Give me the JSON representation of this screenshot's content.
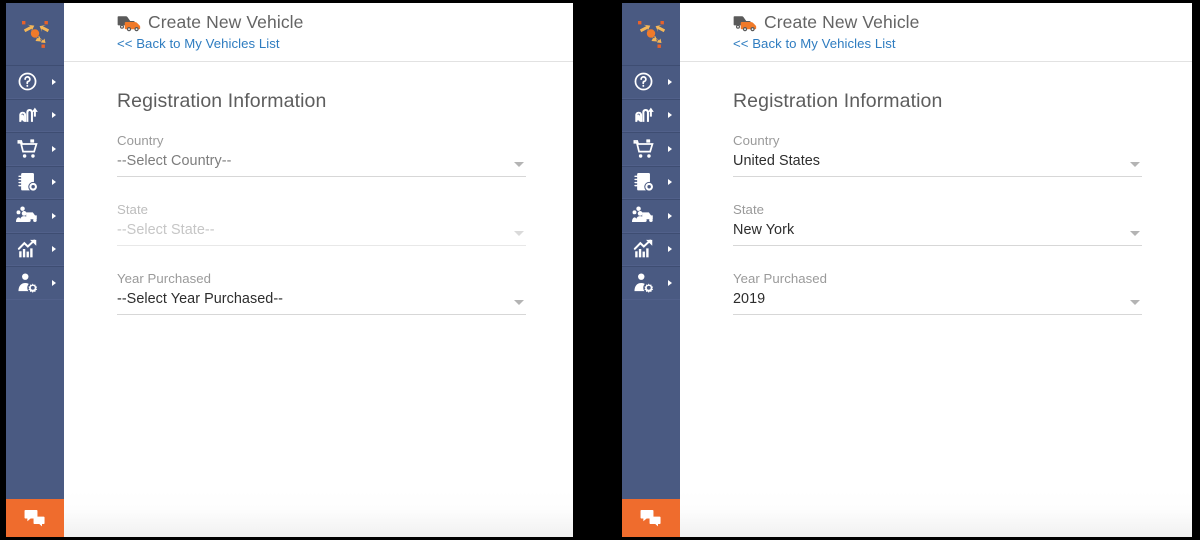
{
  "app": {
    "logo_icon": "route-arrows-logo-icon",
    "sidebar_color": "#4a5a82",
    "accent_color": "#ef6c2d",
    "link_color": "#2e7cc0"
  },
  "sidebar": {
    "chat_icon": "chat-bubbles-icon",
    "items": [
      {
        "icon": "help-question-icon",
        "name": "help"
      },
      {
        "icon": "route-path-icon",
        "name": "routes"
      },
      {
        "icon": "shopping-cart-icon",
        "name": "orders"
      },
      {
        "icon": "notebook-location-icon",
        "name": "logs"
      },
      {
        "icon": "truck-team-icon",
        "name": "fleet"
      },
      {
        "icon": "growth-chart-icon",
        "name": "reports"
      },
      {
        "icon": "user-settings-icon",
        "name": "settings"
      }
    ]
  },
  "header": {
    "title": "Create New Vehicle",
    "title_icon": "vehicle-truck-icon",
    "back_link": "<< Back to My Vehicles List"
  },
  "form": {
    "section_title": "Registration Information",
    "panels": [
      {
        "id": "empty-state",
        "fields": [
          {
            "label": "Country",
            "value": "--Select Country--",
            "is_placeholder": true,
            "disabled": false
          },
          {
            "label": "State",
            "value": "--Select State--",
            "is_placeholder": true,
            "disabled": true
          },
          {
            "label": "Year Purchased",
            "value": "--Select Year Purchased--",
            "is_placeholder": false,
            "disabled": false
          }
        ]
      },
      {
        "id": "filled-state",
        "fields": [
          {
            "label": "Country",
            "value": "United States",
            "is_placeholder": false,
            "disabled": false
          },
          {
            "label": "State",
            "value": "New York",
            "is_placeholder": false,
            "disabled": false
          },
          {
            "label": "Year Purchased",
            "value": "2019",
            "is_placeholder": false,
            "disabled": false
          }
        ]
      }
    ]
  }
}
